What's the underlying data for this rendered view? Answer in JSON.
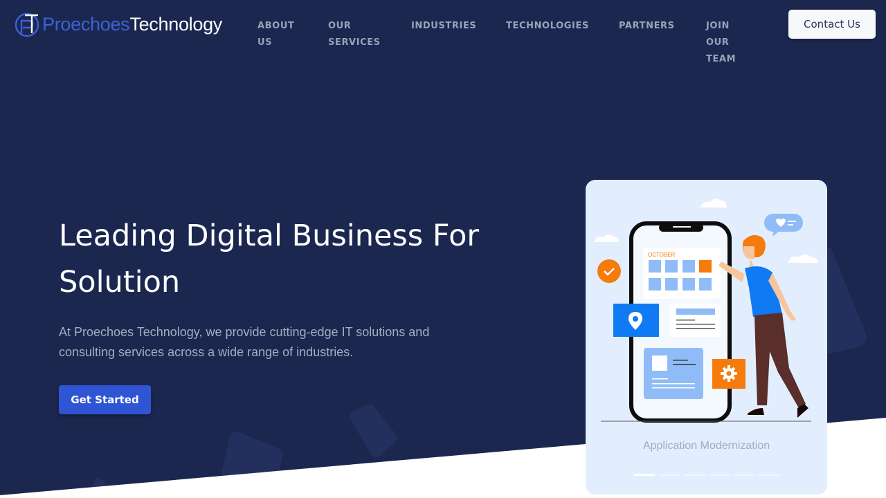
{
  "brand": {
    "name_part1": "Proechoes",
    "name_part2": "Technology",
    "logo_icon": "pt-monogram-logo"
  },
  "nav": {
    "items": [
      {
        "label": "About Us",
        "lines": [
          "ABOUT",
          "US"
        ]
      },
      {
        "label": "Our Services",
        "lines": [
          "OUR",
          "SERVICES"
        ]
      },
      {
        "label": "Industries",
        "lines": [
          "INDUSTRIES"
        ]
      },
      {
        "label": "Technologies",
        "lines": [
          "TECHNOLOGIES"
        ]
      },
      {
        "label": "Partners",
        "lines": [
          "PARTNERS"
        ]
      },
      {
        "label": "Join Our Team",
        "lines": [
          "JOIN",
          "OUR",
          "TEAM"
        ]
      }
    ],
    "contact_label": "Contact Us"
  },
  "hero": {
    "title_line1": "Leading Digital Business For",
    "title_line2": "Solution",
    "description_line1": "At Proechoes Technology, we provide cutting-edge IT solutions and",
    "description_line2": "consulting services across a wide range of industries.",
    "cta_label": "Get Started"
  },
  "slider": {
    "caption": "Application Modernization",
    "calendar_month": "OCTOBER",
    "slide_count": 6,
    "active_index": 0
  },
  "colors": {
    "background": "#1c2750",
    "brand_blue": "#3a63d8",
    "cta_blue": "#2f55d4",
    "card_bg": "#e2eefd",
    "accent_orange": "#f47b0c"
  }
}
